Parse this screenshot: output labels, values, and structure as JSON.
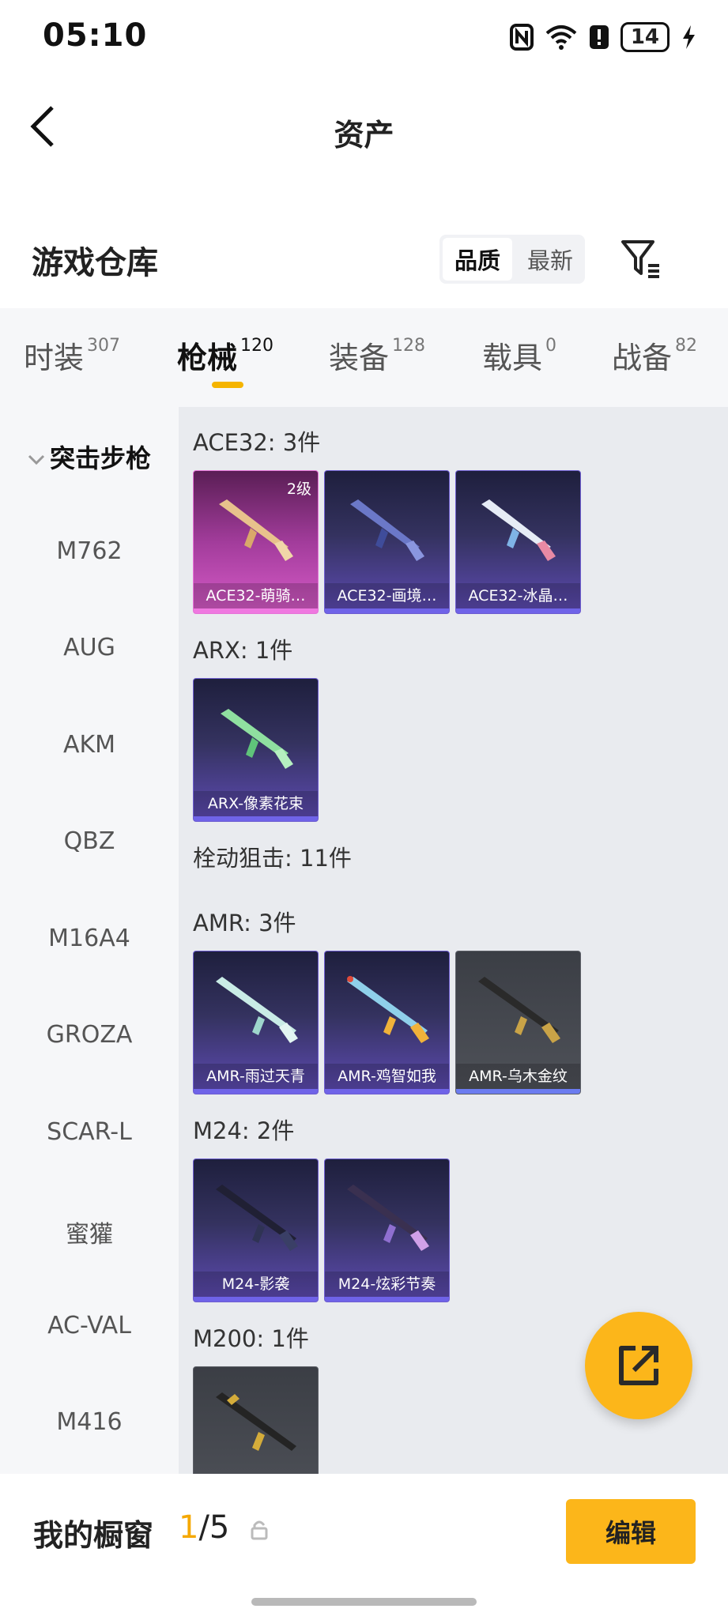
{
  "status_bar": {
    "time": "05:10",
    "battery": "14"
  },
  "header": {
    "title": "资产"
  },
  "section": {
    "title": "游戏仓库",
    "sort_options": [
      "品质",
      "最新"
    ]
  },
  "tabs": [
    {
      "label": "时装",
      "count": "307"
    },
    {
      "label": "枪械",
      "count": "120"
    },
    {
      "label": "装备",
      "count": "128"
    },
    {
      "label": "载具",
      "count": "0"
    },
    {
      "label": "战备",
      "count": "82"
    }
  ],
  "sidebar": {
    "category": "突击步枪",
    "items": [
      "M762",
      "AUG",
      "AKM",
      "QBZ",
      "M16A4",
      "GROZA",
      "SCAR-L",
      "蜜獾",
      "AC-VAL",
      "M416"
    ]
  },
  "groups": [
    {
      "title": "ACE32: 3件",
      "items": [
        {
          "name": "ACE32-萌骑…",
          "level": "2级"
        },
        {
          "name": "ACE32-画境…"
        },
        {
          "name": "ACE32-冰晶…"
        }
      ]
    },
    {
      "title": "ARX: 1件",
      "items": [
        {
          "name": "ARX-像素花束"
        }
      ]
    },
    {
      "title": "栓动狙击: 11件",
      "items": []
    },
    {
      "title": "AMR: 3件",
      "items": [
        {
          "name": "AMR-雨过天青"
        },
        {
          "name": "AMR-鸡智如我"
        },
        {
          "name": "AMR-乌木金纹"
        }
      ]
    },
    {
      "title": "M24: 2件",
      "items": [
        {
          "name": "M24-影袭"
        },
        {
          "name": "M24-炫彩节奏"
        }
      ]
    },
    {
      "title": "M200: 1件",
      "items": [
        {
          "name": ""
        }
      ]
    }
  ],
  "bottom_bar": {
    "label": "我的橱窗",
    "current": "1",
    "total": "/5",
    "edit_label": "编辑"
  },
  "colors": {
    "accent": "#fcb61a",
    "card_purple": "#5e4bb4",
    "card_pink": "#d75bc8"
  }
}
